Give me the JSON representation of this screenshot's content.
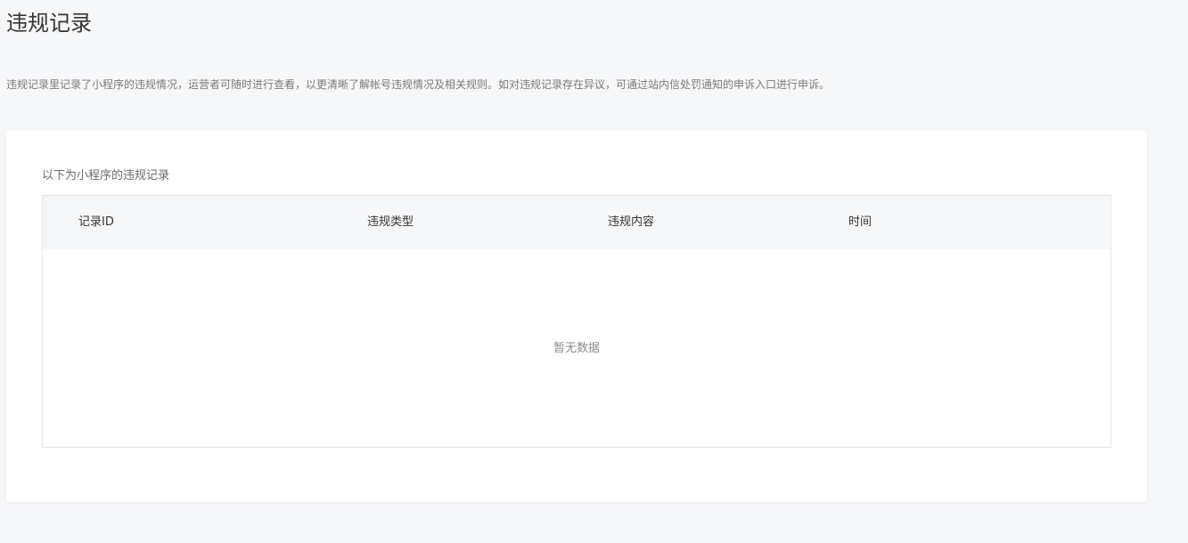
{
  "header": {
    "title": "违规记录",
    "description": "违规记录里记录了小程序的违规情况，运营者可随时进行查看，以更清晰了解帐号违规情况及相关规则。如对违规记录存在异议，可通过站内信处罚通知的申诉入口进行申诉。"
  },
  "records": {
    "subtitle": "以下为小程序的违规记录",
    "columns": [
      "记录ID",
      "违规类型",
      "违规内容",
      "时间"
    ],
    "rows": [],
    "empty_text": "暂无数据"
  },
  "colors": {
    "page_background": "#f6f7f9",
    "card_background": "#ffffff",
    "table_border": "#e4e6eb",
    "header_background": "#f6f7f9"
  }
}
